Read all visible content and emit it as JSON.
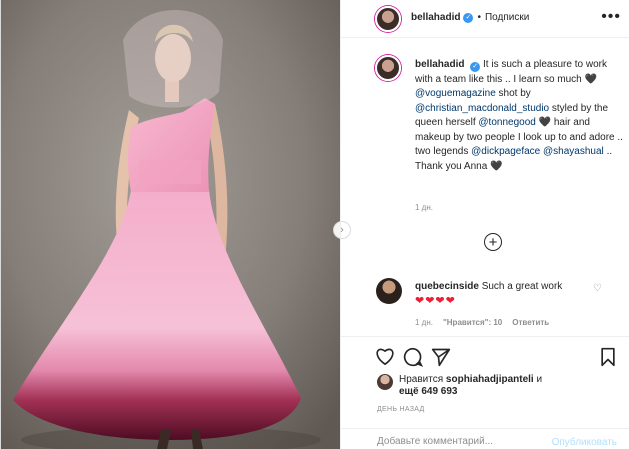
{
  "post": {
    "username": "bellahadid",
    "follow_label": "Подписки",
    "dot": "•",
    "more_label": "•••",
    "caption": {
      "username": "bellahadid",
      "part1": "It is such a pleasure to work with a team like this .. I learn so much",
      "mention_vogue": "@voguemagazine",
      "part2": "shot by",
      "mention_studio": "@christian_macdonald_studio",
      "part3": "styled by the queen herself",
      "mention_tonne": "@tonnegood",
      "part4": "hair and makeup by two people I look up to and adore .. two legends",
      "mention_dick": "@dickpageface",
      "mention_shaya": "@shayashual",
      "part5": ".. Thank you Anna",
      "heart": "🖤",
      "time": "1 дн."
    },
    "load_more_label": "+",
    "comment": {
      "username": "quebecinside",
      "text": "Such a great work",
      "hearts": "❤❤❤❤",
      "time": "1 дн.",
      "likes": "\"Нравится\": 10",
      "reply": "Ответить"
    },
    "likes": {
      "prefix": "Нравится",
      "user": "sophiahadjipanteli",
      "and": "и",
      "rest": "ещё 649 693"
    },
    "date": "ДЕНЬ НАЗАД",
    "add_comment": {
      "placeholder": "Добавьте комментарий...",
      "publish": "Опубликовать"
    }
  },
  "colors": {
    "accent_link": "#00376b",
    "verified": "#3897f0",
    "heart_red": "#ed1d33",
    "dress_pink": "#f3a9c3",
    "dress_wine": "#6b1230"
  },
  "icons": [
    "heart-icon",
    "comment-icon",
    "share-icon",
    "bookmark-icon",
    "plus-circle-icon",
    "more-icon",
    "verified-icon",
    "chevron-right-icon"
  ]
}
